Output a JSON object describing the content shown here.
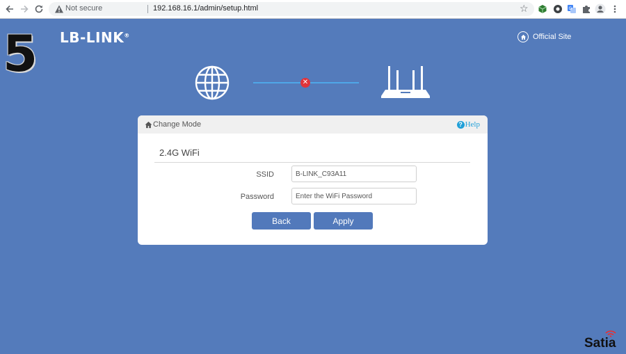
{
  "browser": {
    "security_text": "Not secure",
    "url": "192.168.16.1/admin/setup.html"
  },
  "overlay": {
    "step_number": "5",
    "watermark": "Satia"
  },
  "header": {
    "logo_text": "LB-LINK",
    "logo_trademark": "®",
    "official_site_label": "Official Site"
  },
  "status": {
    "connection_state": "disconnected",
    "error_color": "#e0343a",
    "line_color": "#4fa7e8"
  },
  "panel": {
    "change_mode_label": "Change Mode",
    "help_label": "Help",
    "section_title": "2.4G WiFi",
    "fields": {
      "ssid": {
        "label": "SSID",
        "value": "B-LINK_C93A11"
      },
      "password": {
        "label": "Password",
        "value": "",
        "placeholder": "Enter the WiFi Password"
      }
    },
    "buttons": {
      "back": "Back",
      "apply": "Apply"
    }
  },
  "colors": {
    "page_background": "#547bbb",
    "button": "#5279bb",
    "help": "#21a0d8"
  }
}
